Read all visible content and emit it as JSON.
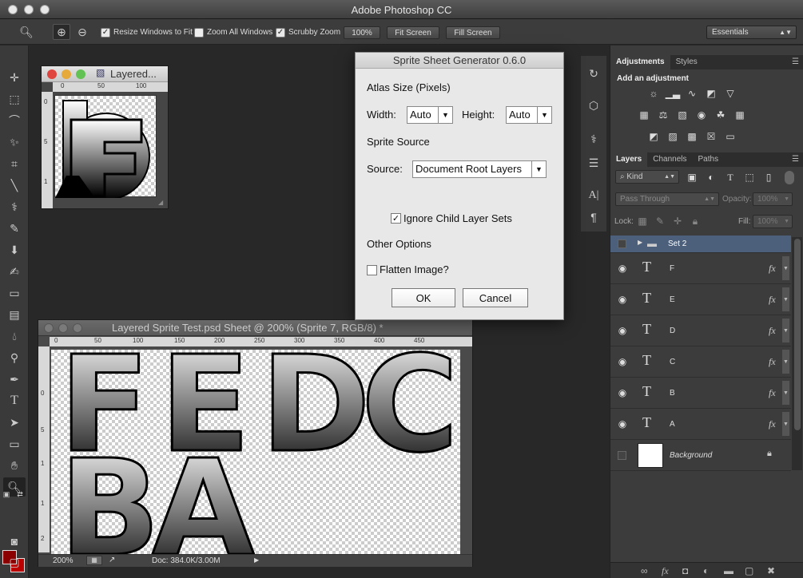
{
  "app": {
    "title": "Adobe Photoshop CC"
  },
  "options_bar": {
    "resize_windows": "Resize Windows to Fit",
    "zoom_all": "Zoom All Windows",
    "scrubby_zoom": "Scrubby Zoom",
    "zoom_100": "100%",
    "fit_screen": "Fit Screen",
    "fill_screen": "Fill Screen",
    "workspace": "Essentials"
  },
  "doc_small": {
    "title": "Layered...",
    "ruler_h": [
      "0",
      "50",
      "100"
    ],
    "ruler_v": [
      "0",
      "5",
      "1"
    ]
  },
  "doc_main": {
    "title": "Layered Sprite Test.psd Sheet @ 200% (Sprite 7, RGB/8) *",
    "ruler_h": [
      "0",
      "50",
      "100",
      "150",
      "200",
      "250",
      "300",
      "350",
      "400",
      "450"
    ],
    "ruler_v": [
      "0",
      "5",
      "1",
      "1",
      "2"
    ],
    "sprite_row1": [
      "F",
      "E",
      "D",
      "C"
    ],
    "sprite_row2": [
      "B",
      "A"
    ],
    "zoom": "200%",
    "doc_info": "Doc: 384.0K/3.00M"
  },
  "dialog": {
    "title": "Sprite Sheet Generator 0.6.0",
    "atlas_size": "Atlas Size (Pixels)",
    "width_label": "Width:",
    "width_value": "Auto",
    "height_label": "Height:",
    "height_value": "Auto",
    "sprite_source": "Sprite Source",
    "source_label": "Source:",
    "source_value": "Document Root Layers",
    "ignore_child": "Ignore Child Layer Sets",
    "other_options": "Other Options",
    "flatten": "Flatten Image?",
    "ok": "OK",
    "cancel": "Cancel"
  },
  "adjustments": {
    "tabs": [
      "Adjustments",
      "Styles"
    ],
    "title": "Add an adjustment"
  },
  "layers": {
    "tabs": [
      "Layers",
      "Channels",
      "Paths"
    ],
    "kind": "Kind",
    "blend_mode": "Pass Through",
    "opacity_label": "Opacity:",
    "opacity_value": "100%",
    "lock_label": "Lock:",
    "fill_label": "Fill:",
    "fill_value": "100%",
    "group_name": "Set 2",
    "items": [
      {
        "name": "F",
        "fx": "fx"
      },
      {
        "name": "E",
        "fx": "fx"
      },
      {
        "name": "D",
        "fx": "fx"
      },
      {
        "name": "C",
        "fx": "fx"
      },
      {
        "name": "B",
        "fx": "fx"
      },
      {
        "name": "A",
        "fx": "fx"
      }
    ],
    "background_name": "Background"
  }
}
